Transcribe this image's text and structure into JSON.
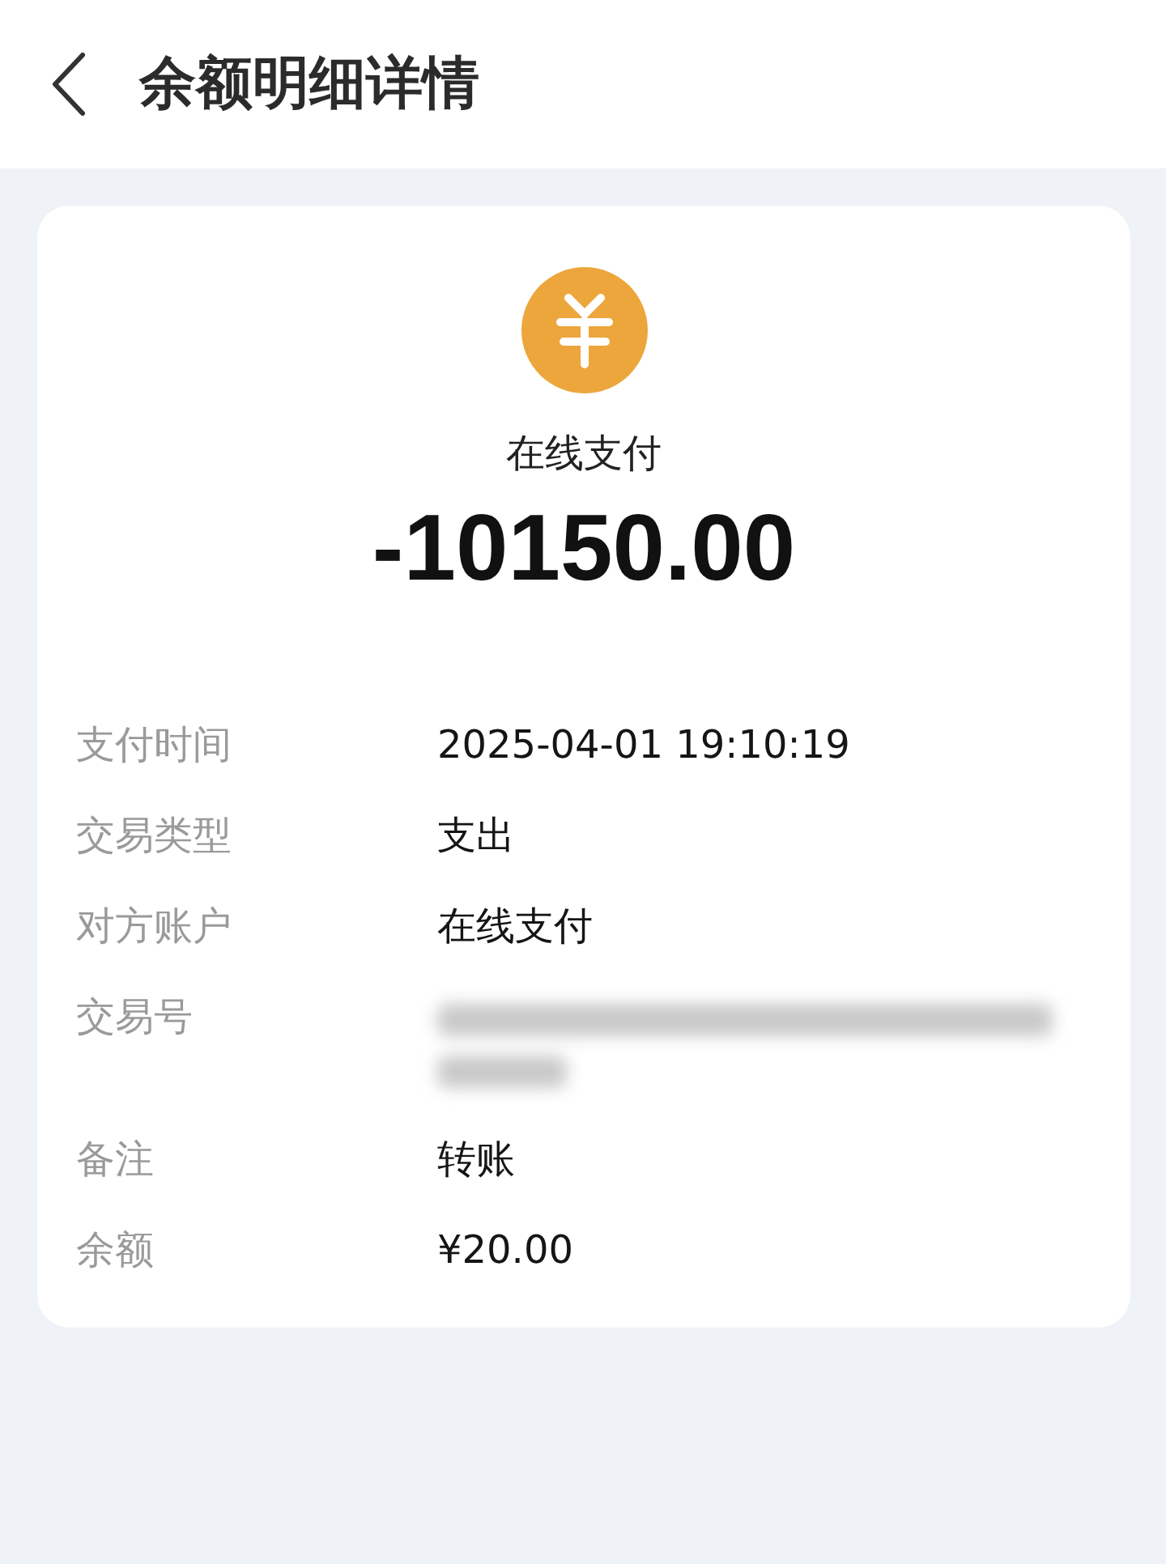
{
  "header": {
    "title": "余额明细详情"
  },
  "summary": {
    "merchant": "在线支付",
    "amount": "-10150.00"
  },
  "details": [
    {
      "kind": "text",
      "label": "支付时间",
      "value": "2025-04-01 19:10:19"
    },
    {
      "kind": "text",
      "label": "交易类型",
      "value": "支出"
    },
    {
      "kind": "text",
      "label": "对方账户",
      "value": "在线支付"
    },
    {
      "kind": "redacted",
      "label": "交易号"
    },
    {
      "kind": "text",
      "label": "备注",
      "value": "转账"
    },
    {
      "kind": "text",
      "label": "余额",
      "value": "¥20.00"
    }
  ]
}
